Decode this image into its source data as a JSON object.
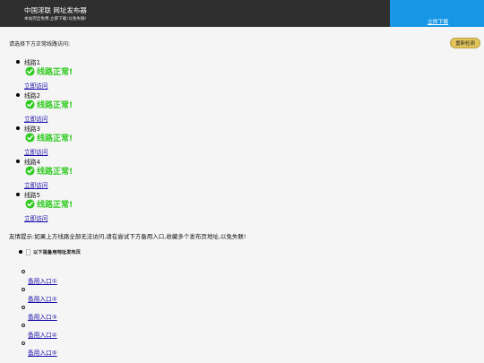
{
  "header": {
    "title": "中国淫联 网址发布器",
    "subtitle": "本站完全免费,立即下载!以免失联!",
    "download_label": "立即下载"
  },
  "main": {
    "prompt": "请选择下方正常线路访问:",
    "recheck_label": "重新检测",
    "status_color": "#2ecb1e",
    "routes": [
      {
        "name": "线路1",
        "status": "线路正常!",
        "link": "立即访问"
      },
      {
        "name": "线路2",
        "status": "线路正常!",
        "link": "立即访问"
      },
      {
        "name": "线路3",
        "status": "线路正常!",
        "link": "立即访问"
      },
      {
        "name": "线路4",
        "status": "线路正常!",
        "link": "立即访问"
      },
      {
        "name": "线路5",
        "status": "线路正常!",
        "link": "立即访问"
      }
    ],
    "tip": "友情提示:如果上方线路全部无法访问,请在尝试下方备用入口,收藏多个发布页地址,以免失联!",
    "backup_heading": "以下是备用地址发布页",
    "backup_links": [
      "备用入口①",
      "备用入口②",
      "备用入口③",
      "备用入口④",
      "备用入口⑤"
    ]
  },
  "colors": {
    "header_bg": "#2f2f2f",
    "download_bg": "#1796e6",
    "recheck_bg": "#e3c55c",
    "link": "#1a0dab"
  },
  "icons": {
    "status": "check-circle-icon",
    "heading_image": "broken-image-icon"
  }
}
